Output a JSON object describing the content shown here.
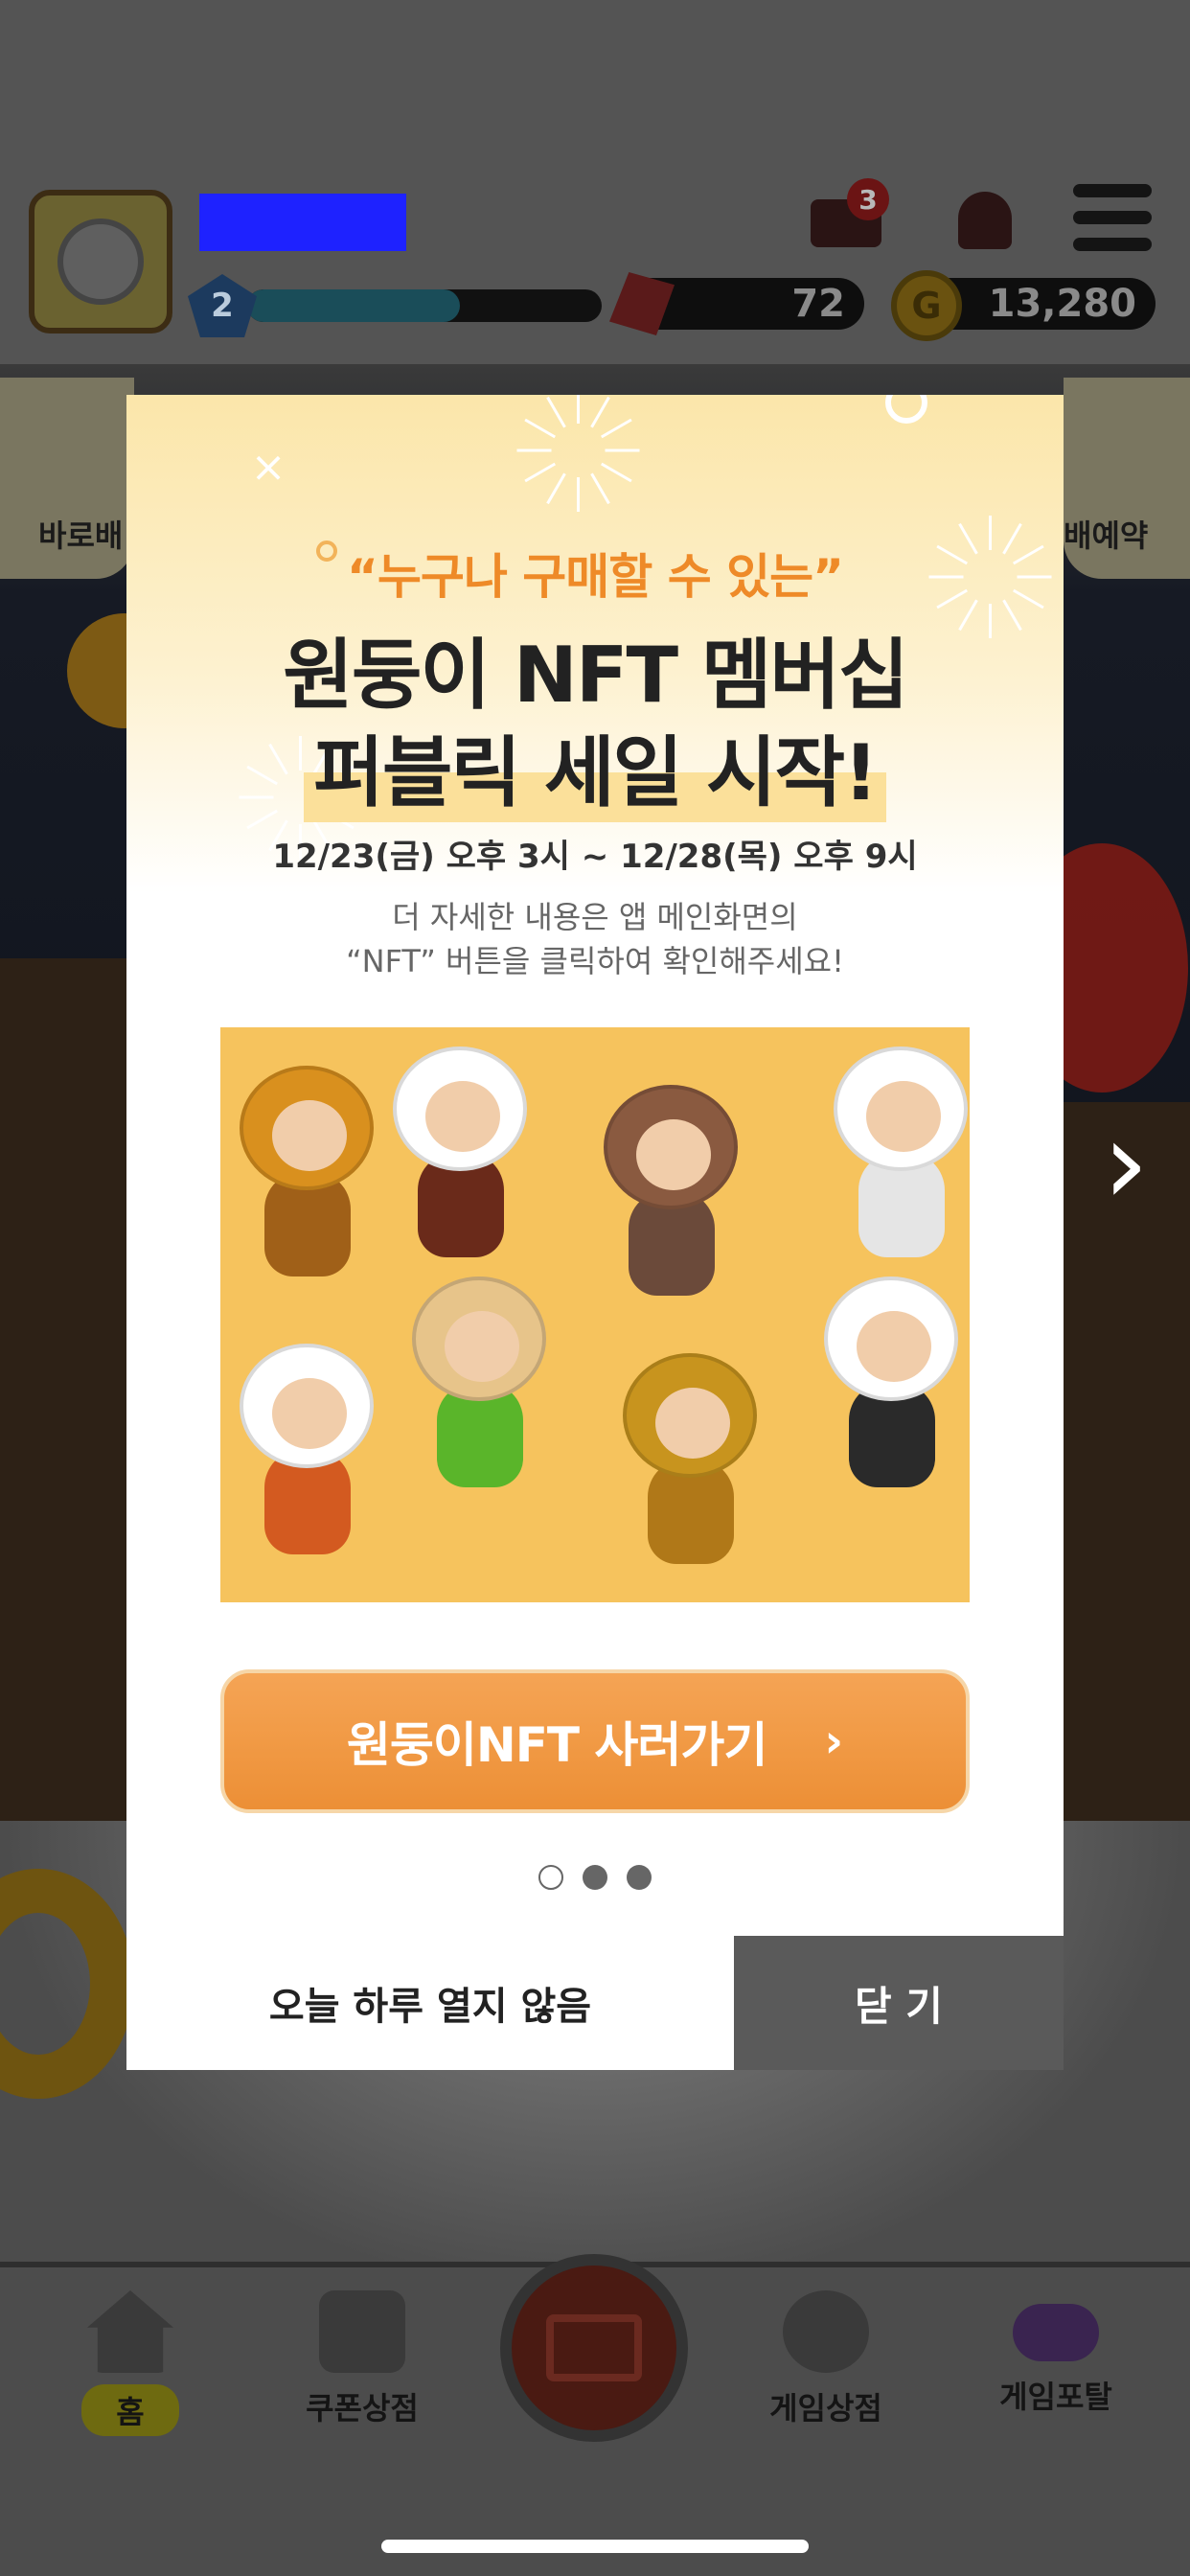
{
  "header": {
    "level": "2",
    "level_progress": 0.6,
    "gems": "72",
    "coins": "13,280",
    "coin_symbol": "G",
    "ticket_badge": "3"
  },
  "side_tabs": {
    "left_label": "바로배",
    "right_label": "배예약"
  },
  "modal": {
    "subtitle": "“누구나 구매할 수 있는”",
    "title_line1": "원둥이 NFT 멤버십",
    "title_line2": "퍼블릭 세일 시작!",
    "date_range": "12/23(금) 오후 3시 ~ 12/28(목) 오후 9시",
    "description_line1": "더 자세한 내용은 앱 메인화면의",
    "description_line2": "“NFT” 버튼을 클릭하여 확인해주세요!",
    "cta_label": "원둥이NFT 사러가기",
    "cta_arrow": "›",
    "close_glyph": "×",
    "dont_show_today": "오늘 하루 열지 않음",
    "close_label": "닫 기",
    "pager_total": 3,
    "pager_active": 1
  },
  "next_arrow": "›",
  "bottom_nav": {
    "items": [
      {
        "label": "홈"
      },
      {
        "label": "쿠폰상점"
      },
      {
        "label": "게임상점"
      },
      {
        "label": "게임포탈"
      }
    ]
  },
  "colors": {
    "accent_orange": "#f19a45",
    "subtitle_orange": "#ee8a28",
    "highlight_yellow": "#fbe09a",
    "close_button_gray": "#5a5a5a",
    "promo_bg": "#f6c35d"
  },
  "icons": {
    "ticket": "ticket-icon",
    "bell": "bell-icon",
    "menu": "hamburger-menu-icon",
    "gem": "ruby-gem-icon",
    "coin": "gold-coin-icon",
    "home": "house-icon",
    "shop": "storefront-icon",
    "game_shop": "gamepad-round-icon",
    "portal": "gamepad-icon",
    "scan": "barcode-scan-icon"
  }
}
